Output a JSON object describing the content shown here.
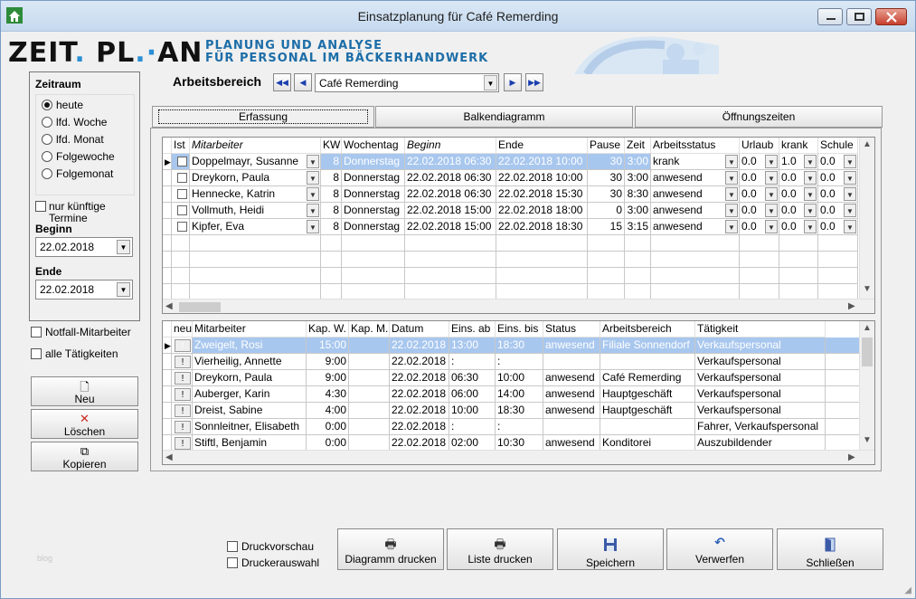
{
  "window": {
    "title": "Einsatzplanung für Café Remerding"
  },
  "logo": {
    "part1": "ZEIT",
    "dot1": ".",
    "part2": " PL",
    "dot2": ".·",
    "part3": "AN",
    "tag1": "PLANUNG UND ANALYSE",
    "tag2": "FÜR PERSONAL IM BÄCKERHANDWERK"
  },
  "zeitraum": {
    "heading": "Zeitraum",
    "options": [
      "heute",
      "lfd. Woche",
      "lfd. Monat",
      "Folgewoche",
      "Folgemonat"
    ],
    "selected_index": 0,
    "future_label": "nur künftige Termine",
    "begin_label": "Beginn",
    "begin_value": "22.02.2018",
    "end_label": "Ende",
    "end_value": "22.02.2018"
  },
  "side_checks": {
    "notfall": "Notfall-Mitarbeiter",
    "alle": "alle Tätigkeiten"
  },
  "side_buttons": {
    "neu": "Neu",
    "loeschen": "Löschen",
    "kopieren": "Kopieren"
  },
  "arbeitsbereich": {
    "label": "Arbeitsbereich",
    "value": "Café Remerding"
  },
  "tabs": [
    "Erfassung",
    "Balkendiagramm",
    "Öffnungszeiten"
  ],
  "top_grid": {
    "headers": [
      "Ist",
      "Mitarbeiter",
      "KW",
      "Wochentag",
      "Beginn",
      "Ende",
      "Pause",
      "Zeit",
      "Arbeitsstatus",
      "Urlaub",
      "krank",
      "Schule"
    ],
    "rows": [
      [
        "",
        "Doppelmayr, Susanne",
        "8",
        "Donnerstag",
        "22.02.2018 06:30",
        "22.02.2018 10:00",
        "30",
        "3:00",
        "krank",
        "0.0",
        "1.0",
        "0.0"
      ],
      [
        "",
        "Dreykorn, Paula",
        "8",
        "Donnerstag",
        "22.02.2018 06:30",
        "22.02.2018 10:00",
        "30",
        "3:00",
        "anwesend",
        "0.0",
        "0.0",
        "0.0"
      ],
      [
        "",
        "Hennecke, Katrin",
        "8",
        "Donnerstag",
        "22.02.2018 06:30",
        "22.02.2018 15:30",
        "30",
        "8:30",
        "anwesend",
        "0.0",
        "0.0",
        "0.0"
      ],
      [
        "",
        "Vollmuth, Heidi",
        "8",
        "Donnerstag",
        "22.02.2018 15:00",
        "22.02.2018 18:00",
        "0",
        "3:00",
        "anwesend",
        "0.0",
        "0.0",
        "0.0"
      ],
      [
        "",
        "Kipfer, Eva",
        "8",
        "Donnerstag",
        "22.02.2018 15:00",
        "22.02.2018 18:30",
        "15",
        "3:15",
        "anwesend",
        "0.0",
        "0.0",
        "0.0"
      ]
    ]
  },
  "bottom_grid": {
    "headers": [
      "neu",
      "Mitarbeiter",
      "Kap. W.",
      "Kap. M.",
      "Datum",
      "Eins. ab",
      "Eins. bis",
      "Status",
      "Arbeitsbereich",
      "Tätigkeit"
    ],
    "rows": [
      [
        "!",
        "Zweigelt, Rosi",
        "15:00",
        "",
        "22.02.2018",
        "13:00",
        "18:30",
        "anwesend",
        "Filiale Sonnendorf",
        "Verkaufspersonal"
      ],
      [
        "!",
        "Vierheilig, Annette",
        "9:00",
        "",
        "22.02.2018",
        ":",
        ":",
        "",
        "",
        "Verkaufspersonal"
      ],
      [
        "!",
        "Dreykorn, Paula",
        "9:00",
        "",
        "22.02.2018",
        "06:30",
        "10:00",
        "anwesend",
        "Café Remerding",
        "Verkaufspersonal"
      ],
      [
        "!",
        "Auberger, Karin",
        "4:30",
        "",
        "22.02.2018",
        "06:00",
        "14:00",
        "anwesend",
        "Hauptgeschäft",
        "Verkaufspersonal"
      ],
      [
        "!",
        "Dreist, Sabine",
        "4:00",
        "",
        "22.02.2018",
        "10:00",
        "18:30",
        "anwesend",
        "Hauptgeschäft",
        "Verkaufspersonal"
      ],
      [
        "!",
        "Sonnleitner, Elisabeth",
        "0:00",
        "",
        "22.02.2018",
        ":",
        ":",
        "",
        "",
        "Fahrer, Verkaufspersonal"
      ],
      [
        "!",
        "Stiftl, Benjamin",
        "0:00",
        "",
        "22.02.2018",
        "02:00",
        "10:30",
        "anwesend",
        "Konditorei",
        "Auszubildender"
      ]
    ]
  },
  "print_checks": {
    "vorschau": "Druckvorschau",
    "auswahl": "Druckerauswahl"
  },
  "bottom_buttons": {
    "diagramm": "Diagramm drucken",
    "liste": "Liste drucken",
    "speichern": "Speichern",
    "verwerfen": "Verwerfen",
    "schliessen": "Schließen"
  },
  "watermark": "blog"
}
